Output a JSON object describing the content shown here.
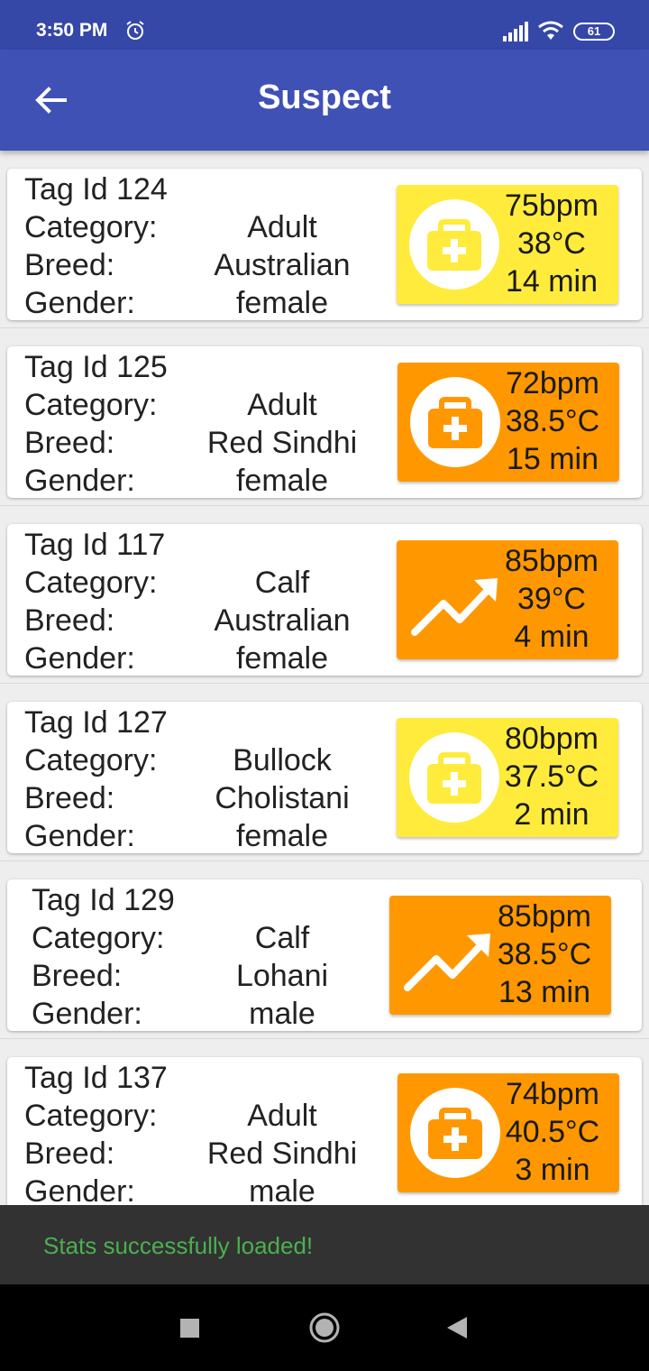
{
  "status_bar": {
    "time": "3:50 PM",
    "battery": "61",
    "icons": [
      "alarm-icon",
      "signal-icon",
      "wifi-icon",
      "battery-icon"
    ]
  },
  "app_bar": {
    "title": "Suspect",
    "back_icon": "arrow-back-icon"
  },
  "labels": {
    "category": "Category:",
    "breed": "Breed:",
    "gender": "Gender:"
  },
  "colors": {
    "app_bar": "#3f51b5",
    "status_bar": "#3548a8",
    "yellow": "#ffeb3b",
    "orange": "#ff9800",
    "snackbar_text": "#4caf50"
  },
  "animals": [
    {
      "tag": "Tag Id 124",
      "category": "Adult",
      "breed": "Australian",
      "gender": "female",
      "status_color": "yellow",
      "icon": "medical-kit-icon",
      "bpm": "75bpm",
      "temp": "38°C",
      "time": "14 min"
    },
    {
      "tag": "Tag Id 125",
      "category": "Adult",
      "breed": "Red Sindhi",
      "gender": "female",
      "status_color": "orange",
      "icon": "medical-kit-icon",
      "bpm": "72bpm",
      "temp": "38.5°C",
      "time": "15 min"
    },
    {
      "tag": "Tag Id 117",
      "category": "Calf",
      "breed": "Australian",
      "gender": "female",
      "status_color": "orange",
      "icon": "trending-up-icon",
      "bpm": "85bpm",
      "temp": "39°C",
      "time": "4 min"
    },
    {
      "tag": "Tag Id 127",
      "category": "Bullock",
      "breed": "Cholistani",
      "gender": "female",
      "status_color": "yellow",
      "icon": "medical-kit-icon",
      "bpm": "80bpm",
      "temp": "37.5°C",
      "time": "2 min"
    },
    {
      "tag": "Tag Id 129",
      "category": "Calf",
      "breed": "Lohani",
      "gender": "male",
      "status_color": "orange",
      "icon": "trending-up-icon",
      "bpm": "85bpm",
      "temp": "38.5°C",
      "time": "13 min"
    },
    {
      "tag": "Tag Id 137",
      "category": "Adult",
      "breed": "Red Sindhi",
      "gender": "male",
      "status_color": "orange",
      "icon": "medical-kit-icon",
      "bpm": "74bpm",
      "temp": "40.5°C",
      "time": "3 min"
    }
  ],
  "snackbar": {
    "message": "Stats successfully loaded!"
  },
  "nav_bar": {
    "icons": [
      "recent-apps-icon",
      "home-icon",
      "back-triangle-icon"
    ]
  }
}
